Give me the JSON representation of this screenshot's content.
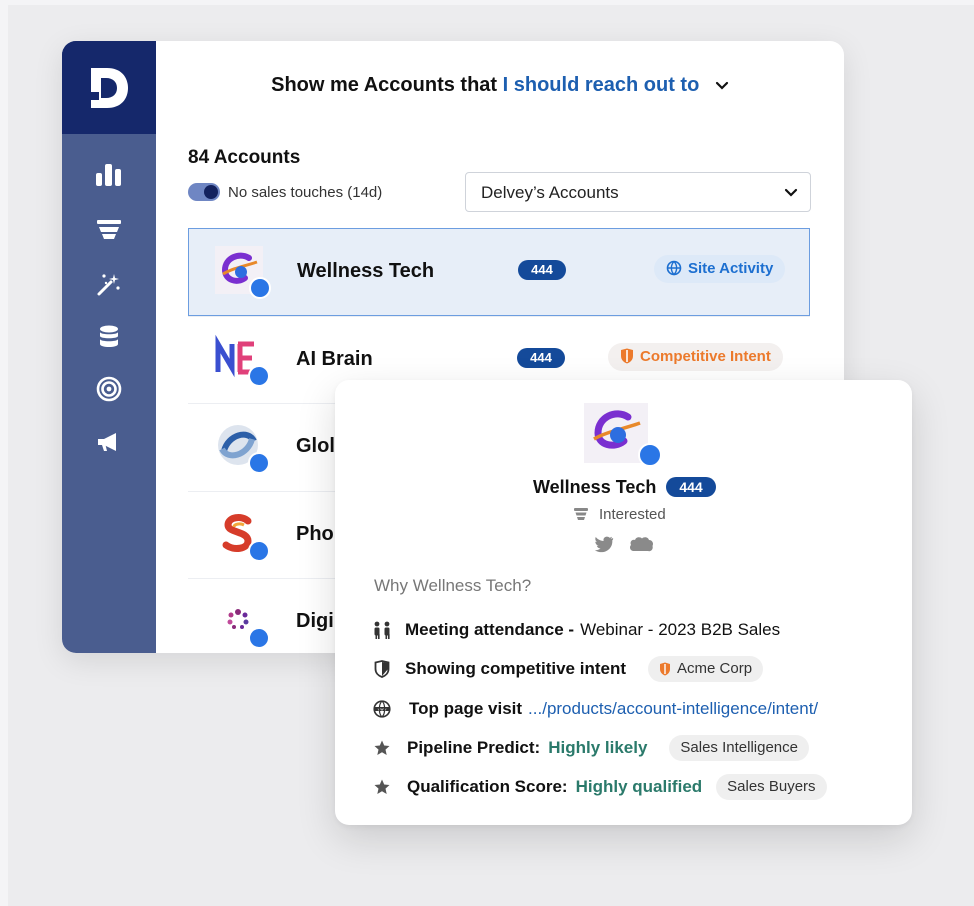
{
  "app": {
    "logo_letter": "D",
    "nav": [
      {
        "icon": "bar-chart-icon"
      },
      {
        "icon": "funnel-icon"
      },
      {
        "icon": "magic-wand-icon"
      },
      {
        "icon": "database-icon"
      },
      {
        "icon": "target-icon"
      },
      {
        "icon": "megaphone-icon"
      }
    ]
  },
  "headline": {
    "prefix": "Show me Accounts that",
    "accent": "I should reach out to"
  },
  "accounts": {
    "count_label": "84 Accounts",
    "toggle_label": "No sales touches (14d)",
    "toggle_on": true,
    "owner_select": "Delvey’s Accounts",
    "rows": [
      {
        "name": "Wellness Tech",
        "score": "444",
        "tag": "Site Activity",
        "tag_type": "site"
      },
      {
        "name": "AI Brain",
        "score": "444",
        "tag": "Competitive Intent",
        "tag_type": "competitive"
      },
      {
        "name": "Glol",
        "score": "",
        "tag": "",
        "tag_type": ""
      },
      {
        "name": "Pho",
        "score": "",
        "tag": "",
        "tag_type": ""
      },
      {
        "name": "Digi",
        "score": "",
        "tag": "",
        "tag_type": ""
      }
    ]
  },
  "card": {
    "name": "Wellness Tech",
    "score": "444",
    "stage": "Interested",
    "why_label": "Why Wellness Tech?",
    "reasons": {
      "meeting": {
        "label": "Meeting attendance -",
        "value": "Webinar - 2023 B2B Sales"
      },
      "competitive": {
        "label": "Showing competitive intent",
        "chip": "Acme Corp"
      },
      "page_visit": {
        "label": "Top page visit",
        "value": ".../products/account-intelligence/intent/"
      },
      "pipeline": {
        "label": "Pipeline Predict:",
        "value": "Highly likely",
        "chip": "Sales Intelligence"
      },
      "qualification": {
        "label": "Qualification Score:",
        "value": "Highly qualified",
        "chip": "Sales Buyers"
      }
    }
  },
  "colors": {
    "sidebar": "#4a5d8f",
    "logo_bg": "#15286b",
    "accent_blue": "#1d5fb0",
    "score_badge": "#144a9a",
    "competitive_orange": "#ec7a2c",
    "teal": "#2b7a6b",
    "status_dot": "#2a76e6"
  }
}
